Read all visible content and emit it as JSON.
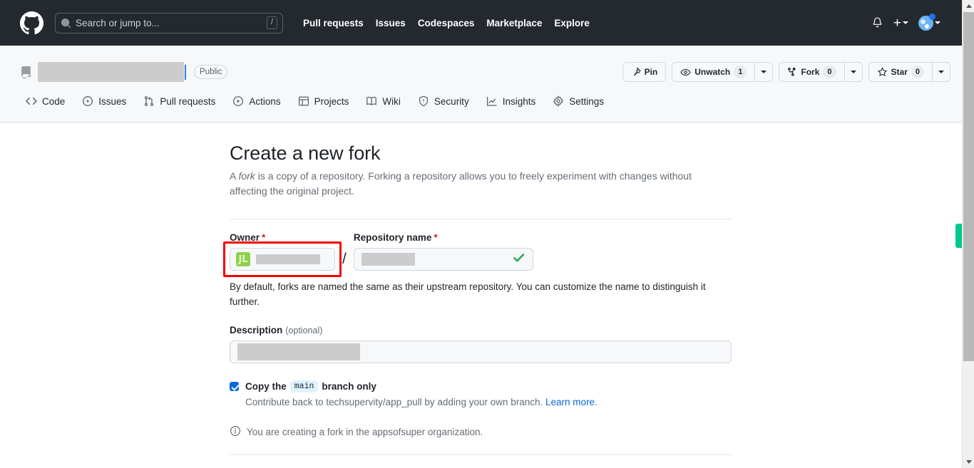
{
  "header": {
    "logo_icon": "github-logo-icon",
    "search": {
      "placeholder": "Search or jump to...",
      "shortcut_key": "/",
      "icon": "search-icon"
    },
    "nav": [
      {
        "label": "Pull requests"
      },
      {
        "label": "Issues"
      },
      {
        "label": "Codespaces"
      },
      {
        "label": "Marketplace"
      },
      {
        "label": "Explore"
      }
    ],
    "notifications_icon": "bell-icon",
    "create_new_glyph": "+",
    "avatar_icon": "user-avatar",
    "bg_color": "#24292f"
  },
  "repo": {
    "repo_icon": "repo-icon",
    "name_redacted": true,
    "visibility_badge": "Public",
    "actions": [
      {
        "label": "Pin",
        "icon": "pin-icon",
        "count": null,
        "has_caret": false
      },
      {
        "label": "Unwatch",
        "icon": "eye-icon",
        "count": "1",
        "has_caret": true
      },
      {
        "label": "Fork",
        "icon": "fork-icon",
        "count": "0",
        "has_caret": true
      },
      {
        "label": "Star",
        "icon": "star-icon",
        "count": "0",
        "has_caret": true
      }
    ],
    "tabs": [
      {
        "label": "Code",
        "icon": "code-icon"
      },
      {
        "label": "Issues",
        "icon": "issue-opened-icon"
      },
      {
        "label": "Pull requests",
        "icon": "git-pull-request-icon"
      },
      {
        "label": "Actions",
        "icon": "play-icon"
      },
      {
        "label": "Projects",
        "icon": "table-icon"
      },
      {
        "label": "Wiki",
        "icon": "book-icon"
      },
      {
        "label": "Security",
        "icon": "shield-icon"
      },
      {
        "label": "Insights",
        "icon": "graph-icon"
      },
      {
        "label": "Settings",
        "icon": "gear-icon"
      }
    ]
  },
  "fork_form": {
    "title": "Create a new fork",
    "description_line1": "A fork is a copy of a repository. Forking a repository allows you to freely experiment with changes without",
    "description_line2": "affecting the original project.",
    "description_italic_word": "fork",
    "owner": {
      "label": "Owner",
      "required_marker": "*",
      "avatar_initials": "JL",
      "value_redacted": true,
      "highlighted": true,
      "highlight_color": "#f60000"
    },
    "separator": "/",
    "repository_name": {
      "label": "Repository name",
      "required_marker": "*",
      "value_redacted": true,
      "valid_icon": "check-icon",
      "valid_color": "#2da44e"
    },
    "helper_text": "By default, forks are named the same as their upstream repository. You can customize the name to distinguish it further.",
    "description_field": {
      "label": "Description",
      "optional_tag": "(optional)",
      "value_redacted": true
    },
    "copy_branch": {
      "checked": true,
      "text_before": "Copy the",
      "branch_name": "main",
      "text_after": "branch only",
      "sub_text": "Contribute back to techsupervity/app_pull by adding your own branch.",
      "link_label": "Learn more."
    },
    "org_note": {
      "icon": "info-icon",
      "text": "You are creating a fork in the appsofsuper organization."
    }
  },
  "chrome": {
    "scrollbar_up_icon": "scroll-up-arrow-icon",
    "scrollbar_down_icon": "scroll-down-arrow-icon",
    "edge_marker_color": "#00c98d"
  }
}
